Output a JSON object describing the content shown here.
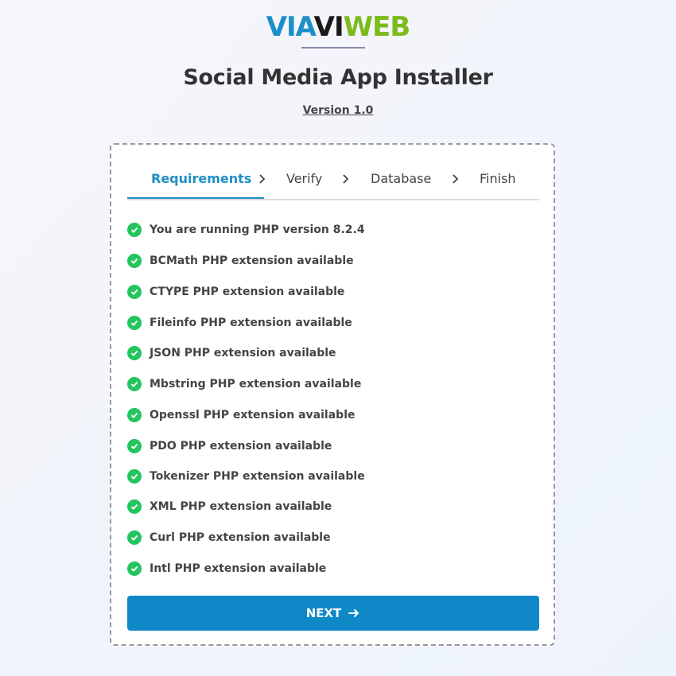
{
  "brand": {
    "part1": "VIA",
    "part2": "VI",
    "part3": "WEB"
  },
  "header": {
    "title": "Social Media App Installer",
    "version": "Version 1.0"
  },
  "tabs": [
    {
      "label": "Requirements",
      "active": true
    },
    {
      "label": "Verify",
      "active": false
    },
    {
      "label": "Database",
      "active": false
    },
    {
      "label": "Finish",
      "active": false
    }
  ],
  "requirements": [
    "You are running PHP version 8.2.4",
    "BCMath PHP extension available",
    "CTYPE PHP extension available",
    "Fileinfo PHP extension available",
    "JSON PHP extension available",
    "Mbstring PHP extension available",
    "Openssl PHP extension available",
    "PDO PHP extension available",
    "Tokenizer PHP extension available",
    "XML PHP extension available",
    "Curl PHP extension available",
    "Intl PHP extension available"
  ],
  "next_button": {
    "label": "NEXT",
    "icon": "arrow-right-icon"
  },
  "colors": {
    "accent": "#1d8fc7",
    "button": "#0f88c8",
    "check": "#23c55e",
    "logo_green": "#7cbb1b"
  }
}
